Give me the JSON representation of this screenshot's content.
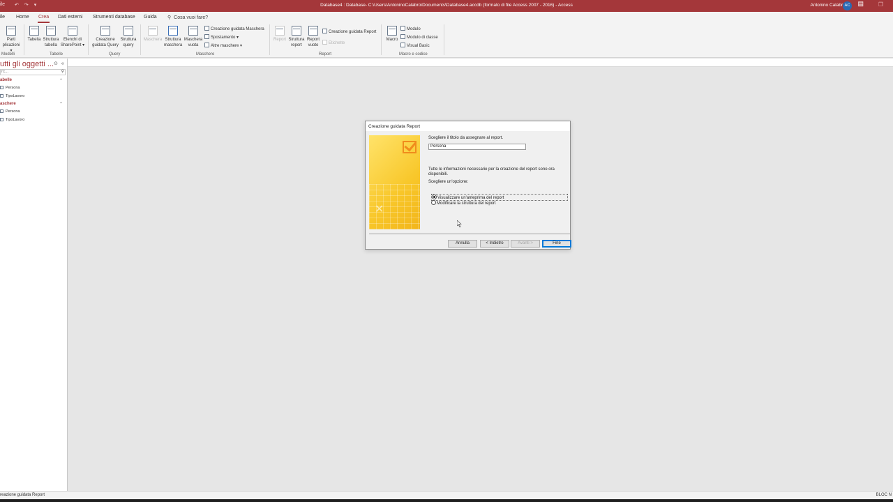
{
  "titlebar": {
    "qat": [
      "ile",
      "↶",
      "↷",
      "▾"
    ],
    "title": "Database4 : Database- C:\\Users\\AntoninoCalabro\\Documents\\Database4.accdb (formato di file Access 2007 - 2016)  -  Access",
    "user": "Antonino Calabro'",
    "avatar": "AC"
  },
  "tabs": {
    "file": "ile",
    "home": "Home",
    "crea": "Crea",
    "dati": "Dati esterni",
    "strumenti": "Strumenti database",
    "guida": "Guida",
    "tellme": "Cosa vuoi fare?"
  },
  "ribbon": {
    "parti_line1": "Parti",
    "parti_line2": "plicazioni ▾",
    "tabella": "Tabella",
    "struttura_tabella_1": "Struttura",
    "struttura_tabella_2": "tabella",
    "elenchi_1": "Elenchi di",
    "elenchi_2": "SharePoint ▾",
    "creazione_query_1": "Creazione",
    "creazione_query_2": "guidata Query",
    "struttura_query_1": "Struttura",
    "struttura_query_2": "query",
    "maschera": "Maschera",
    "struttura_maschera_1": "Struttura",
    "struttura_maschera_2": "maschera",
    "maschera_vuota_1": "Maschera",
    "maschera_vuota_2": "vuota",
    "creazione_maschera": "Creazione guidata Maschera",
    "spostamento": "Spostamento ▾",
    "altre_maschere": "Altre maschere ▾",
    "report": "Report",
    "struttura_report_1": "Struttura",
    "struttura_report_2": "report",
    "report_vuoto_1": "Report",
    "report_vuoto_2": "vuoto",
    "creazione_report": "Creazione guidata Report",
    "etichette": "Etichette",
    "macro": "Macro",
    "modulo": "Modulo",
    "modulo_classe": "Modulo di classe",
    "visual_basic": "Visual Basic",
    "groups": {
      "modelli": "Modelli",
      "tabelle": "Tabelle",
      "query": "Query",
      "maschere": "Maschere",
      "report": "Report",
      "macro": "Macro e codice"
    }
  },
  "nav": {
    "title": "utti gli oggetti ...",
    "search_placeholder": "rc...",
    "sections": [
      {
        "label": "abelle",
        "items": [
          "Persona",
          "TipoLavoro"
        ]
      },
      {
        "label": "aschere",
        "items": [
          "Persona",
          "TipoLavoro"
        ]
      }
    ]
  },
  "dialog": {
    "title": "Creazione guidata Report",
    "prompt_title": "Scegliere il titolo da assegnare al report.",
    "report_title": "Persona",
    "info_line1": "Tutte le informazioni necessarie per la creazione del report sono ora",
    "info_line2": "disponibili.",
    "choose": "Scegliere un'opzione:",
    "option_preview": "Visualizzare un'anteprima del report",
    "option_modify": "Modificare la struttura del report",
    "btn_cancel": "Annulla",
    "btn_back": "< Indietro",
    "btn_next": "Avanti >",
    "btn_finish": "Fine"
  },
  "status": {
    "left": "reazione guidata Report",
    "right": "BLOC N"
  }
}
